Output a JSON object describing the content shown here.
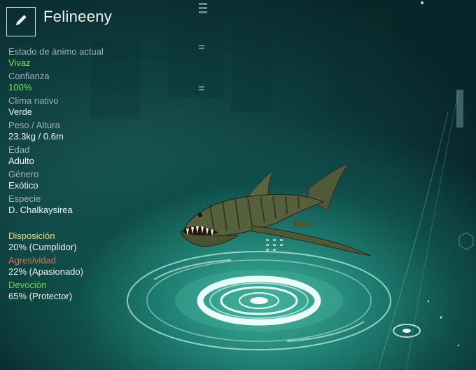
{
  "creature_name": "Felineeny",
  "edit_icon": "pencil-icon",
  "stats": [
    {
      "label": "Estado de ánimo actual",
      "value": "Vivaz"
    },
    {
      "label": "Confianza",
      "value": "100%"
    },
    {
      "label": "Clima nativo",
      "value": "Verde"
    },
    {
      "label": "Peso / Altura",
      "value": "23.3kg / 0.6m"
    },
    {
      "label": "Edad",
      "value": "Adulto"
    },
    {
      "label": "Género",
      "value": "Exótico"
    },
    {
      "label": "Especie",
      "value": "D. Chalkaysirea"
    }
  ],
  "traits": [
    {
      "label": "Disposición",
      "value": "20% (Cumplidor)",
      "color": "#e8e07a"
    },
    {
      "label": "Agresividad",
      "value": "22% (Apasionado)",
      "color": "#e0704e"
    },
    {
      "label": "Devoción",
      "value": "65% (Protector)",
      "color": "#6fd24a"
    }
  ],
  "colors": {
    "highlight_value": "#7be35a",
    "label": "#9fb3b1",
    "value": "#f2f2f2"
  }
}
